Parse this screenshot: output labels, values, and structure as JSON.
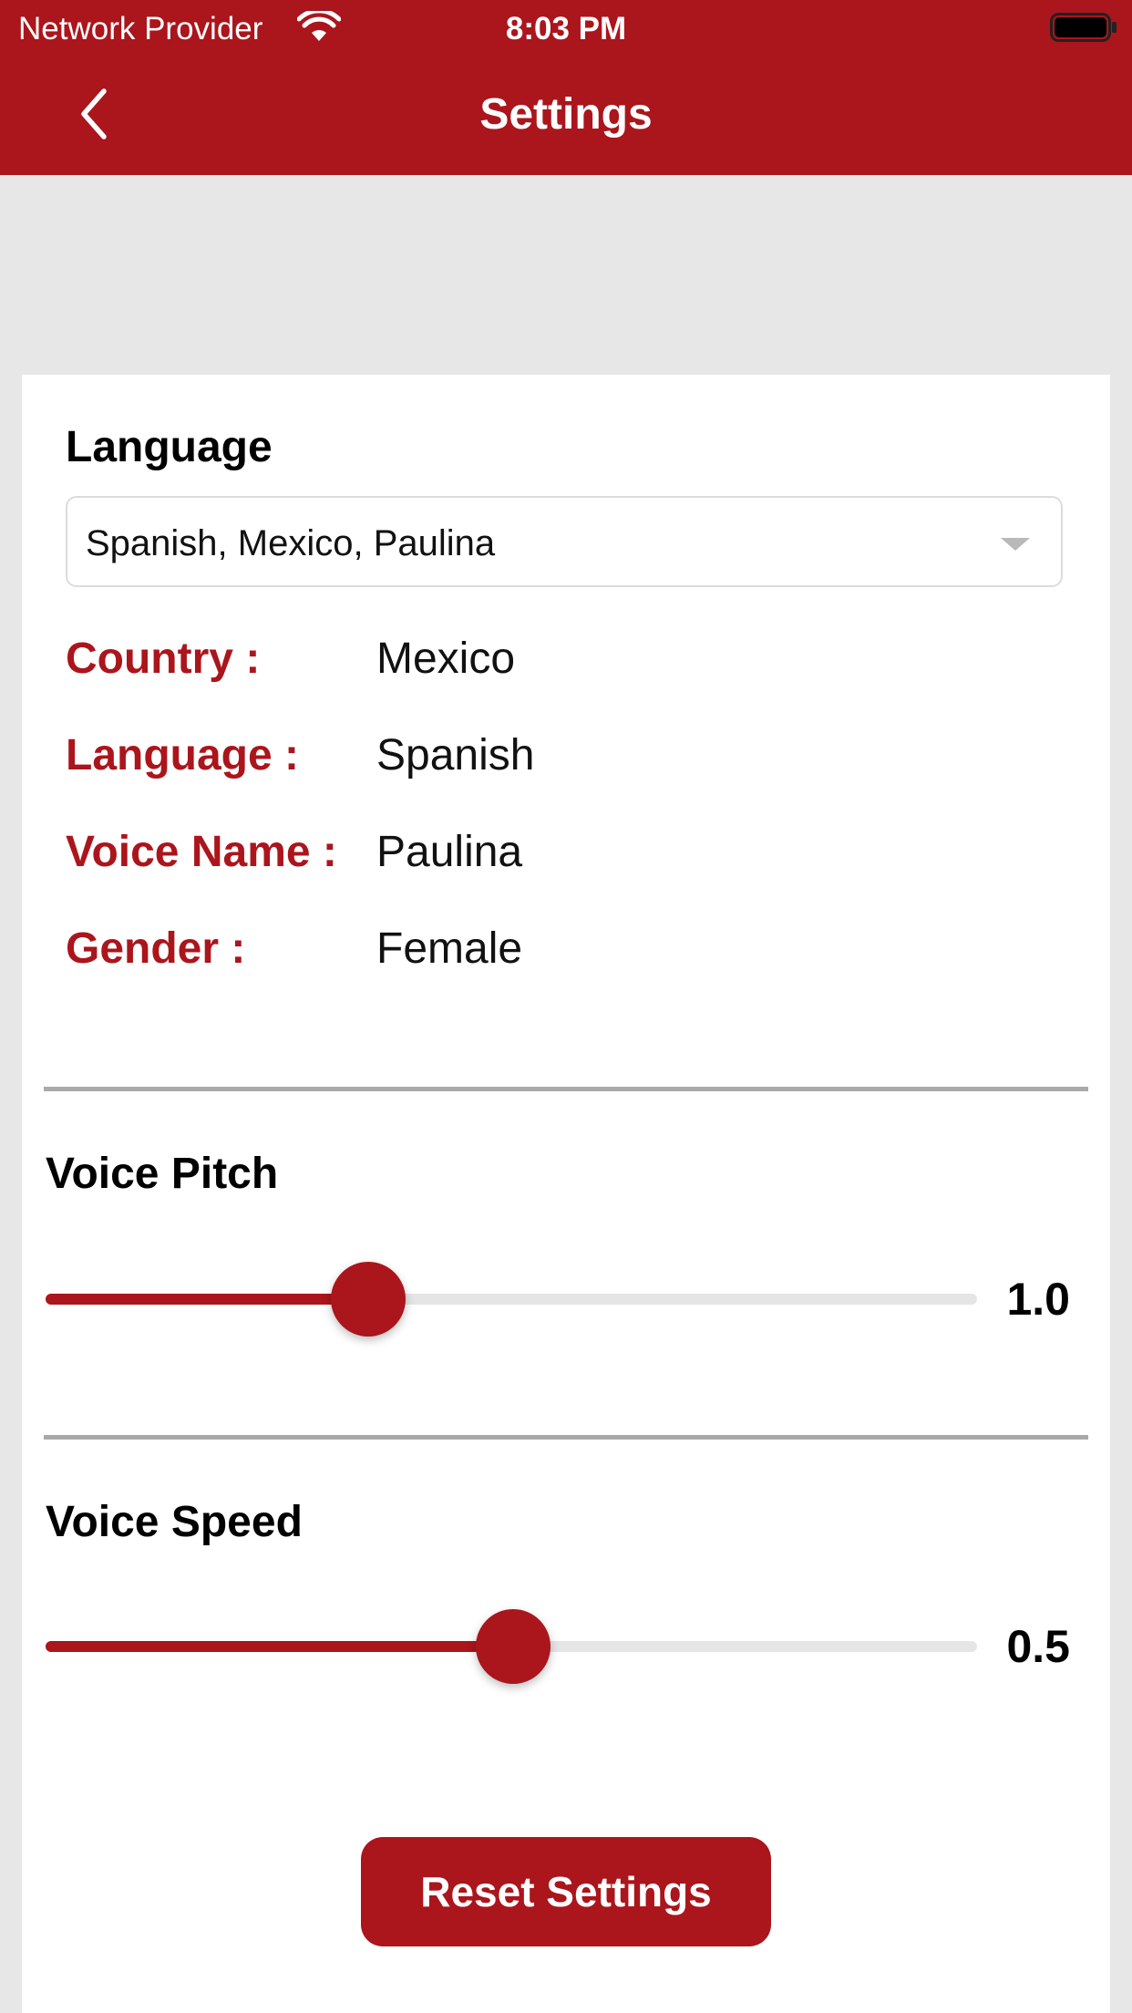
{
  "status_bar": {
    "carrier": "Network Provider",
    "time": "8:03 PM",
    "wifi_icon": "wifi-icon",
    "battery_icon": "battery-full-icon"
  },
  "nav": {
    "title": "Settings",
    "back_icon": "chevron-left-icon"
  },
  "language_section": {
    "heading": "Language",
    "dropdown_value": "Spanish, Mexico, Paulina",
    "details": [
      {
        "label": "Country :",
        "value": "Mexico"
      },
      {
        "label": "Language :",
        "value": "Spanish"
      },
      {
        "label": "Voice Name :",
        "value": "Paulina"
      },
      {
        "label": "Gender :",
        "value": "Female"
      }
    ]
  },
  "pitch": {
    "heading": "Voice Pitch",
    "value_label": "1.0",
    "fraction": 0.346
  },
  "speed": {
    "heading": "Voice Speed",
    "value_label": "0.5",
    "fraction": 0.502
  },
  "reset_button_label": "Reset Settings",
  "colors": {
    "accent": "#ab151c",
    "background": "#e7e7e7",
    "card": "#ffffff",
    "track": "#e5e5e5"
  }
}
